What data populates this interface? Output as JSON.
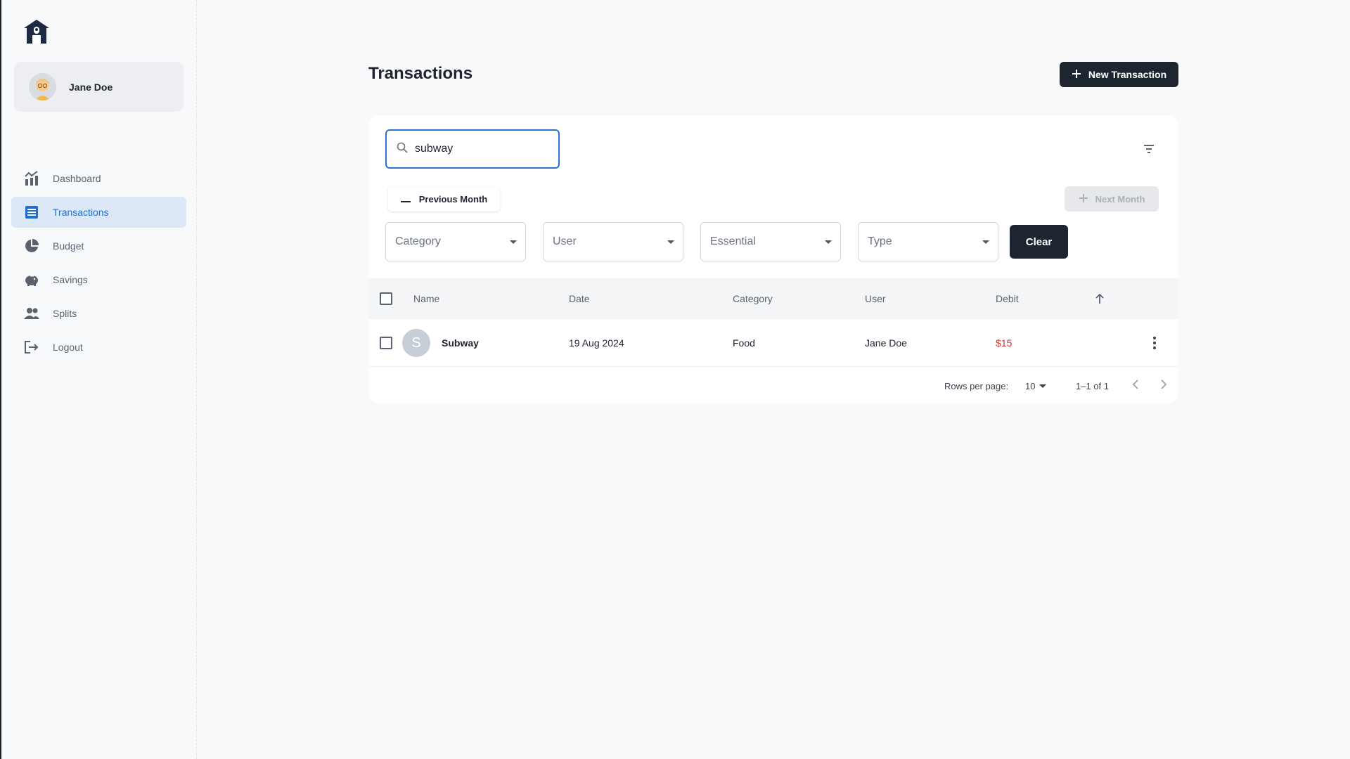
{
  "user": {
    "name": "Jane Doe"
  },
  "nav": [
    {
      "label": "Dashboard",
      "icon": "chart-icon"
    },
    {
      "label": "Transactions",
      "icon": "list-icon"
    },
    {
      "label": "Budget",
      "icon": "pie-icon"
    },
    {
      "label": "Savings",
      "icon": "piggy-bank-icon"
    },
    {
      "label": "Splits",
      "icon": "people-icon"
    },
    {
      "label": "Logout",
      "icon": "logout-icon"
    }
  ],
  "header": {
    "title": "Transactions",
    "new_button": "New Transaction"
  },
  "search": {
    "value": "subway"
  },
  "month_nav": {
    "previous": "Previous Month",
    "next": "Next Month"
  },
  "filters": {
    "category": "Category",
    "user": "User",
    "essential": "Essential",
    "type": "Type",
    "clear": "Clear"
  },
  "table": {
    "columns": {
      "name": "Name",
      "date": "Date",
      "category": "Category",
      "user": "User",
      "debit": "Debit"
    },
    "rows": [
      {
        "initial": "S",
        "name": "Subway",
        "date": "19 Aug 2024",
        "category": "Food",
        "user": "Jane Doe",
        "debit": "$15"
      }
    ]
  },
  "pagination": {
    "rows_per_page_label": "Rows per page:",
    "rows_per_page": "10",
    "range": "1–1 of 1"
  },
  "colors": {
    "accent": "#2b74d3",
    "active_nav_bg": "#dce8f7",
    "dark_button": "#1d2530",
    "debit": "#d32f2f"
  }
}
